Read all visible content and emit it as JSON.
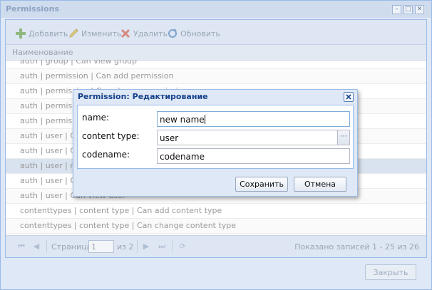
{
  "window": {
    "title": "Permissions",
    "close_button_label": "Закрыть"
  },
  "toolbar": {
    "add_label": "Добавить",
    "edit_label": "Изменить",
    "delete_label": "Удалить",
    "refresh_label": "Обновить"
  },
  "grid": {
    "column_header": "Наименование",
    "rows": [
      "auth | group | Can view group",
      "auth | permission | Can add permission",
      "auth | permission | Can change permission",
      "auth | permission | Can delete permission",
      "auth | permission | Can view permission",
      "auth | user | Can add user",
      "auth | user | Can change user",
      "auth | user | new name",
      "auth | user | Can delete user",
      "auth | user | Can view user",
      "contenttypes | content type | Can add content type",
      "contenttypes | content type | Can change content type"
    ]
  },
  "pager": {
    "page_label": "Страница",
    "page_value": "1",
    "of_label": "из 2",
    "summary": "Показано записей 1 - 25 из 26"
  },
  "dialog": {
    "title": "Permission: Редактирование",
    "fields": [
      {
        "label": "name:",
        "value": "new name"
      },
      {
        "label": "content type:",
        "value": "user"
      },
      {
        "label": "codename:",
        "value": "codename"
      }
    ],
    "save_label": "Сохранить",
    "cancel_label": "Отмена"
  }
}
